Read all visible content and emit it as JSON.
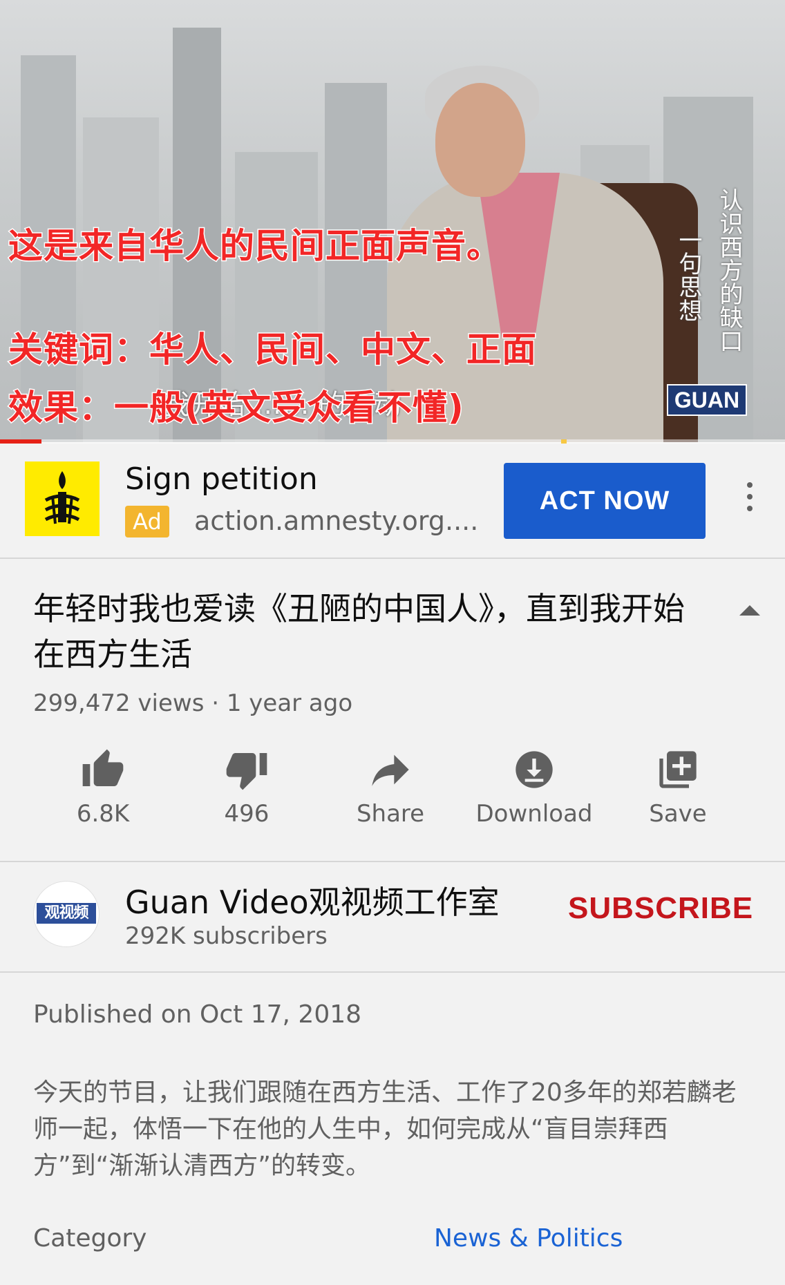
{
  "video": {
    "overlay_line1": "这是来自华人的民间正面声音。",
    "overlay_line2": "关键词：华人、民间、中文、正面",
    "overlay_line3": "效果：一般(英文受众看不懂)",
    "burned_subtitle": "我开始 …… 的运动",
    "vertical_caption_1": "认识西方的缺口",
    "vertical_caption_2": "一句思想",
    "channel_badge": "GUAN",
    "progress_played_fraction": 0.053
  },
  "ad": {
    "logo_icon": "candle-barbed-wire-icon",
    "title": "Sign petition",
    "badge": "Ad",
    "url": "action.amnesty.org....",
    "cta": "ACT NOW"
  },
  "details": {
    "title": "年轻时我也爱读《丑陋的中国人》，直到我开始在西方生活",
    "meta": "299,472 views · 1 year ago"
  },
  "actions": {
    "like": "6.8K",
    "dislike": "496",
    "share": "Share",
    "download": "Download",
    "save": "Save"
  },
  "channel": {
    "avatar_text": "观视频",
    "name": "Guan Video观视频工作室",
    "subscribers": "292K subscribers",
    "subscribe": "SUBSCRIBE"
  },
  "description": {
    "published": "Published on Oct 17, 2018",
    "body": "今天的节目，让我们跟随在西方生活、工作了20多年的郑若麟老师一起，体悟一下在他的人生中，如何完成从“盲目崇拜西方”到“渐渐认清西方”的转变。",
    "category_label": "Category",
    "category_value": "News & Politics"
  },
  "colors": {
    "accent_red": "#c4161c",
    "cta_blue": "#1a5ccc",
    "link_blue": "#1a63d4",
    "ad_yellow": "#f3b52f"
  }
}
